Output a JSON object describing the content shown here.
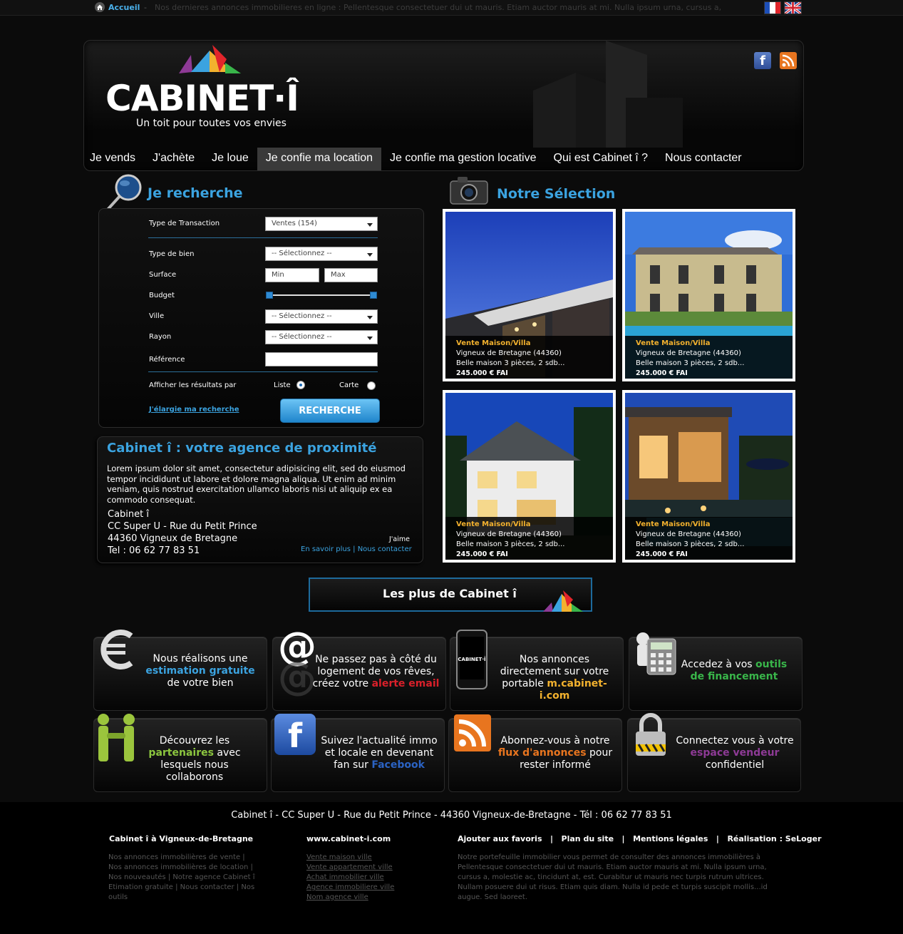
{
  "topbar": {
    "home": "Accueil",
    "separator": "-",
    "marquee": "Nos dernieres annonces immobilieres en ligne : Pellentesque consectetuer dui ut mauris. Etiam auctor mauris at mi. Nulla ipsum urna, cursus a,",
    "languages": [
      "fr",
      "en"
    ]
  },
  "header": {
    "logo": "CABINET·Î",
    "tagline": "Un toit pour toutes vos envies",
    "social": [
      "facebook-icon",
      "rss-icon"
    ]
  },
  "nav": {
    "items": [
      "Je vends",
      "J'achète",
      "Je loue",
      "Je confie ma location",
      "Je confie ma gestion locative",
      "Qui est Cabinet î ?",
      "Nous contacter"
    ],
    "active": "Je confie ma location"
  },
  "search": {
    "title": "Je recherche",
    "transaction_label": "Type de Transaction",
    "transaction_value": "Ventes (154)",
    "bien_label": "Type de bien",
    "bien_value": "-- Sélectionnez --",
    "surface_label": "Surface",
    "surface_min": "Min",
    "surface_max": "Max",
    "budget_label": "Budget",
    "ville_label": "Ville",
    "ville_value": "-- Sélectionnez --",
    "rayon_label": "Rayon",
    "rayon_value": "-- Sélectionnez --",
    "reference_label": "Référence",
    "reference_value": "",
    "display_label": "Afficher les résultats par",
    "option_list": "Liste",
    "option_map": "Carte",
    "selected_display": "Liste",
    "widen_link": "J'élargie ma recherche",
    "button": "RECHERCHE"
  },
  "agency": {
    "title": "Cabinet î : votre agence de proximité",
    "text": "Lorem ipsum dolor sit amet, consectetur adipisicing elit, sed do eiusmod tempor incididunt ut labore et dolore magna aliqua. Ut enim ad minim veniam, quis nostrud exercitation ullamco laboris nisi ut aliquip ex ea commodo consequat.",
    "name": "Cabinet î",
    "address1": "CC Super U - Rue du Petit Prince",
    "address2": "44360 Vigneux de Bretagne",
    "phone": "Tel : 06 62 77 83 51",
    "like": "J'aime",
    "link_more": "En savoir plus",
    "link_sep": "|",
    "link_contact": "Nous contacter"
  },
  "selection": {
    "title": "Notre Sélection",
    "cards": [
      {
        "type": "Vente Maison/Villa",
        "city": "Vigneux de Bretagne (44360)",
        "desc": "Belle maison 3 pièces, 2 sdb...",
        "price": "245.000 € FAI"
      },
      {
        "type": "Vente Maison/Villa",
        "city": "Vigneux de Bretagne (44360)",
        "desc": "Belle maison 3 pièces, 2 sdb...",
        "price": "245.000 € FAI"
      },
      {
        "type": "Vente Maison/Villa",
        "city": "Vigneux de Bretagne (44360)",
        "desc": "Belle maison 3 pièces, 2 sdb...",
        "price": "245.000 € FAI"
      },
      {
        "type": "Vente Maison/Villa",
        "city": "Vigneux de Bretagne (44360)",
        "desc": "Belle maison 3 pièces, 2 sdb...",
        "price": "245.000 € FAI"
      }
    ]
  },
  "plus": {
    "title": "Les plus de Cabinet î",
    "tiles": [
      {
        "pre": "Nous réalisons une ",
        "hl": "estimation gratuite",
        "post": " de votre bien",
        "color": "#3ba3e0",
        "icon": "euro-icon"
      },
      {
        "pre": "Ne passez pas à côté du logement de vos rêves, créez votre ",
        "hl": "alerte email",
        "post": "",
        "color": "#d9202a",
        "icon": "at-icon"
      },
      {
        "pre": "Nos annonces directement sur votre portable ",
        "hl": "m.cabinet-i.com",
        "post": "",
        "color": "#f2b12e",
        "icon": "phone-icon"
      },
      {
        "pre": "Accedez à vos ",
        "hl": "outils de financement",
        "post": "",
        "color": "#39b54a",
        "icon": "calculator-icon"
      },
      {
        "pre": "Découvrez les ",
        "hl": "partenaires",
        "post": " avec lesquels nous collaborons",
        "color": "#8cc63f",
        "icon": "partners-icon"
      },
      {
        "pre": "Suivez l'actualité immo et locale en devenant fan sur ",
        "hl": "Facebook",
        "post": "",
        "color": "#2b63c4",
        "icon": "facebook-icon"
      },
      {
        "pre": "Abonnez-vous à notre ",
        "hl": "flux d'annonces",
        "post": " pour rester informé",
        "color": "#e8751f",
        "icon": "rss-icon"
      },
      {
        "pre": "Connectez vous à votre ",
        "hl": "espace vendeur",
        "post": " confidentiel",
        "color": "#8e3a96",
        "icon": "lock-icon"
      }
    ]
  },
  "footer": {
    "address": "Cabinet î - CC Super U - Rue du Petit Prince - 44360 Vigneux-de-Bretagne - Tél : 06 62 77 83 51",
    "col1_title": "Cabinet î à Vigneux-de-Bretagne",
    "col1_links": "Nos annonces immobilières de vente | Nos annonces immobilières de location | Nos nouveautés | Notre agence Cabinet î Etimation gratuite | Nous contacter | Nos outils",
    "col2_title": "www.cabinet-i.com",
    "col2_links": [
      "Vente maison ville",
      "Vente appartement ville",
      "Achat immobilier ville",
      "Agence immobiliere ville",
      "Nom agence ville"
    ],
    "col3_links": [
      "Ajouter aux favoris",
      "Plan du site",
      "Mentions légales",
      "Réalisation : SeLoger"
    ],
    "col3_sep": "|",
    "col3_text": "Notre portefeuille immobilier vous permet de consulter des annonces immobilières à Pellentesque consectetuer dui ut mauris. Etiam auctor mauris at mi. Nulla ipsum urna, cursus a, molestie ac, tincidunt at, est. Curabitur ut mauris nec turpis rutrum ultrices. Nullam posuere dui ut risus. Etiam quis diam. Nulla id pede et turpis suscipit mollis...id augue. Sed laoreet."
  }
}
